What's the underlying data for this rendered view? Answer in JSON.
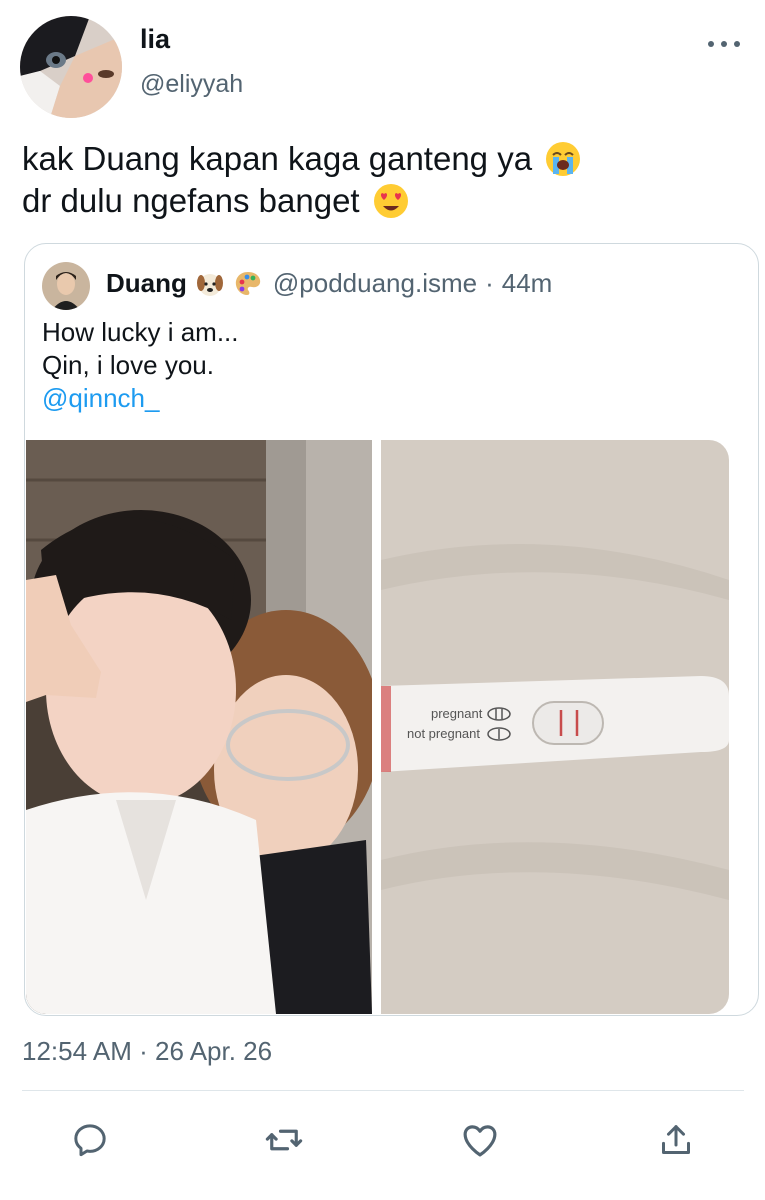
{
  "author": {
    "display_name": "lia",
    "handle": "@eliyyah"
  },
  "tweet": {
    "line1": "kak Duang kapan kaga ganteng ya",
    "line1_emoji": "loudly-crying-face-emoji",
    "line2": "dr dulu ngefans banget",
    "line2_emoji": "heart-eyes-emoji"
  },
  "quoted": {
    "display_name": "Duang",
    "name_emojis": [
      "dog-face-emoji",
      "artist-palette-emoji"
    ],
    "handle": "@podduang.isme",
    "separator": "·",
    "time": "44m",
    "text_line1": "How lucky i am...",
    "text_line2": "Qin, i love you.",
    "mention": "@qinnch_",
    "photos": [
      {
        "subject": "selfie-photo"
      },
      {
        "subject": "pregnancy-test-photo",
        "test_label_1": "pregnant",
        "test_label_2": "not pregnant"
      }
    ]
  },
  "meta": {
    "time": "12:54 AM",
    "separator": "·",
    "date": "26 Apr. 26"
  },
  "actions": [
    {
      "icon": "reply-icon"
    },
    {
      "icon": "retweet-icon"
    },
    {
      "icon": "like-icon"
    },
    {
      "icon": "share-icon"
    }
  ],
  "colors": {
    "text": "#0f1419",
    "secondary": "#536471",
    "link": "#1d9bf0",
    "border": "#cfd9de"
  }
}
